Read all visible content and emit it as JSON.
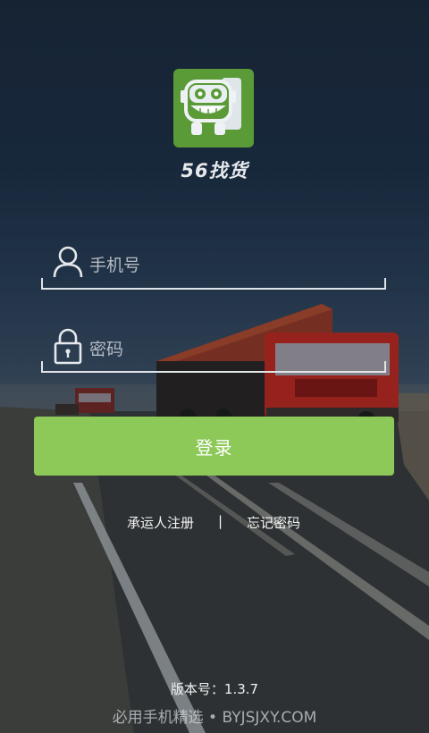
{
  "app": {
    "name": "56找货",
    "logo_icon": "truck-face-logo",
    "brand_color": "#5a9a37"
  },
  "login_form": {
    "phone_placeholder": "手机号",
    "phone_icon": "user-icon",
    "password_placeholder": "密码",
    "password_icon": "lock-icon",
    "login_label": "登录",
    "button_color": "#8cc958"
  },
  "links": {
    "register": "承运人注册",
    "divider": "|",
    "forgot_password": "忘记密码"
  },
  "footer": {
    "version": "版本号：1.3.7",
    "watermark": "必用手机精选 • BYJSJXY.COM"
  }
}
